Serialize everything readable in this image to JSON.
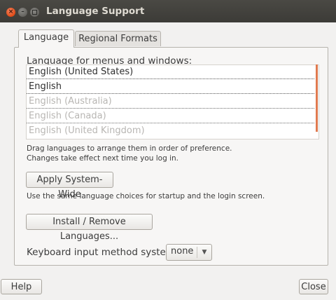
{
  "window": {
    "title": "Language Support"
  },
  "tabs": [
    {
      "label": "Language",
      "active": true
    },
    {
      "label": "Regional Formats",
      "active": false
    }
  ],
  "language_section": {
    "label": "Language for menus and windows:",
    "languages": [
      {
        "name": "English (United States)",
        "enabled": true
      },
      {
        "name": "English",
        "enabled": true
      },
      {
        "name": "English (Australia)",
        "enabled": false
      },
      {
        "name": "English (Canada)",
        "enabled": false
      },
      {
        "name": "English (United Kingdom)",
        "enabled": false
      }
    ],
    "hint_line1": "Drag languages to arrange them in order of preference.",
    "hint_line2": "Changes take effect next time you log in."
  },
  "apply_button": {
    "label": "Apply System-Wide",
    "description": "Use the same language choices for startup and the login screen."
  },
  "install_button": {
    "label": "Install / Remove Languages..."
  },
  "keyboard": {
    "label": "Keyboard input method system:",
    "value": "none"
  },
  "footer": {
    "help_label": "Help",
    "close_label": "Close"
  },
  "colors": {
    "titlebar": "#3c3b37",
    "close_button": "#df4a16",
    "scroll_indicator": "#e07a4f",
    "window_bg": "#f2f1f0"
  },
  "icons": {
    "close": "close-icon",
    "minimize": "minimize-icon",
    "maximize": "maximize-icon",
    "dropdown": "chevron-down-icon"
  }
}
